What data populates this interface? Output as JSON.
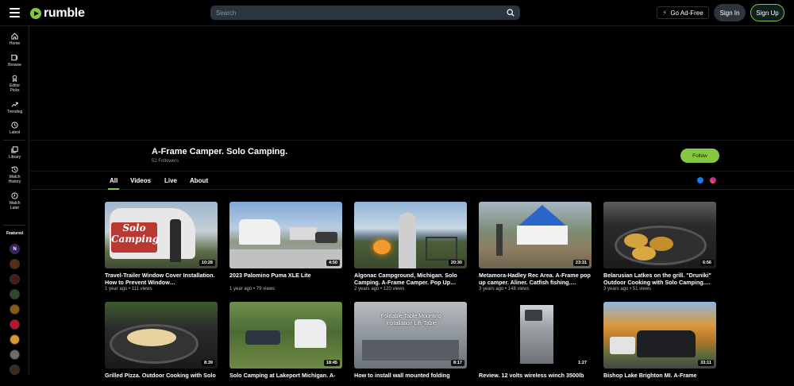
{
  "header": {
    "logo_text": "rumble",
    "search_placeholder": "Search",
    "go_adfree_label": "Go Ad-Free",
    "signin_label": "Sign In",
    "signup_label": "Sign Up",
    "brand_color": "#85c742"
  },
  "sidebar": {
    "items": [
      {
        "label": "Home",
        "icon": "home-icon"
      },
      {
        "label": "Browse",
        "icon": "browse-icon"
      },
      {
        "label": "Editor Picks",
        "icon": "award-icon"
      },
      {
        "label": "Trending",
        "icon": "trending-icon"
      },
      {
        "label": "Latest",
        "icon": "clock-icon"
      },
      {
        "label": "Library",
        "icon": "library-icon"
      },
      {
        "label": "Watch History",
        "icon": "history-icon"
      },
      {
        "label": "Watch Later",
        "icon": "watch-later-icon"
      }
    ],
    "featured_label": "Featured"
  },
  "channel": {
    "title": "A-Frame Camper. Solo Camping.",
    "followers": "52 Followers",
    "follow_label": "Follow"
  },
  "tabs": [
    {
      "label": "All",
      "active": true
    },
    {
      "label": "Videos",
      "active": false
    },
    {
      "label": "Live",
      "active": false
    },
    {
      "label": "About",
      "active": false
    }
  ],
  "videos": [
    {
      "title": "Travel-Trailer Window Cover Installation. How to Prevent Window…",
      "meta": "1 year ago • 111 views",
      "duration": "10:28",
      "thumb_text": "Solo Camping"
    },
    {
      "title": "2023 Palomino Puma XLE Lite",
      "meta": "1 year ago • 79 views",
      "duration": "4:50"
    },
    {
      "title": "Algonac Campground, Michigan. Solo Camping. A-Frame Camper. Pop Up…",
      "meta": "2 years ago • 120 views",
      "duration": "20:30"
    },
    {
      "title": "Metamora-Hadley Rec Area. A-Frame pop up camper. Aliner. Catfish fishing.…",
      "meta": "3 years ago • 148 views",
      "duration": "23:31"
    },
    {
      "title": "Belarusian Latkes on the grill. \"Druniki\" Outdoor Cooking with Solo Camping.…",
      "meta": "3 years ago • 51 views",
      "duration": "6:56"
    },
    {
      "title": "Grilled Pizza. Outdoor Cooking with Solo",
      "meta": "",
      "duration": "8:39"
    },
    {
      "title": "Solo Camping at Lakeport Michigan. A-",
      "meta": "",
      "duration": "18:45"
    },
    {
      "title": "How to install wall mounted folding",
      "meta": "",
      "duration": "8:17",
      "thumb_text": "Foldable Table Mounting Installation Lift-Table"
    },
    {
      "title": "Review. 12 volts wireless winch 3500lb",
      "meta": "",
      "duration": "1:27"
    },
    {
      "title": "Bishop Lake Brighton MI. A-Frame",
      "meta": "",
      "duration": "33:11"
    }
  ]
}
